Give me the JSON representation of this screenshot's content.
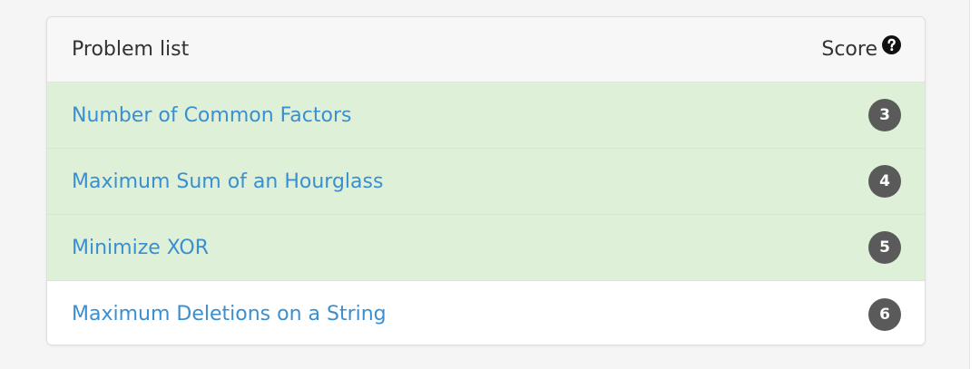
{
  "panel": {
    "header": {
      "title": "Problem list",
      "score_label": "Score",
      "help_icon": "question-circle-icon"
    },
    "problems": [
      {
        "name": "Number of Common Factors",
        "score": "3",
        "solved": true
      },
      {
        "name": "Maximum Sum of an Hourglass",
        "score": "4",
        "solved": true
      },
      {
        "name": "Minimize XOR",
        "score": "5",
        "solved": true
      },
      {
        "name": "Maximum Deletions on a String",
        "score": "6",
        "solved": false
      }
    ]
  },
  "colors": {
    "solved_row": "#dff0d8",
    "link": "#3a8fd0",
    "badge": "#5a5a5a"
  }
}
